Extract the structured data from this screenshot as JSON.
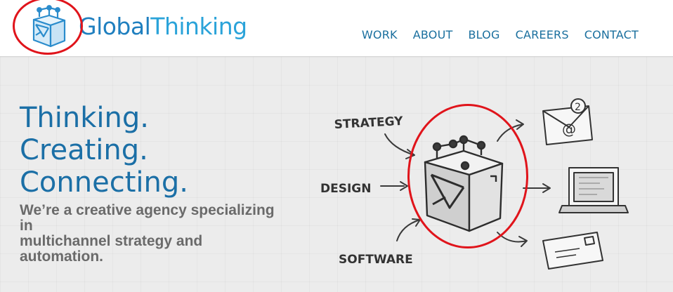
{
  "brand": {
    "name_part1": "Global",
    "name_part2": "Thinking"
  },
  "nav": {
    "items": [
      "WORK",
      "ABOUT",
      "BLOG",
      "CAREERS",
      "CONTACT"
    ]
  },
  "hero": {
    "headline": [
      "Thinking.",
      "Creating.",
      "Connecting."
    ],
    "tagline": [
      "We’re a creative agency specializing",
      "in",
      "multichannel strategy and",
      "automation."
    ]
  },
  "diagram": {
    "labels": {
      "strategy": "STRATEGY",
      "design": "DESIGN",
      "software": "SOFTWARE"
    },
    "email_badge": "2",
    "email_symbol": "@"
  },
  "colors": {
    "brand_dark": "#1b6fa6",
    "brand_light": "#2aa3d9",
    "highlight": "#e0141b"
  },
  "icons": [
    "logo-cube-icon",
    "envelope-icon",
    "laptop-icon",
    "mail-envelope-icon",
    "cube-illustration-icon"
  ]
}
